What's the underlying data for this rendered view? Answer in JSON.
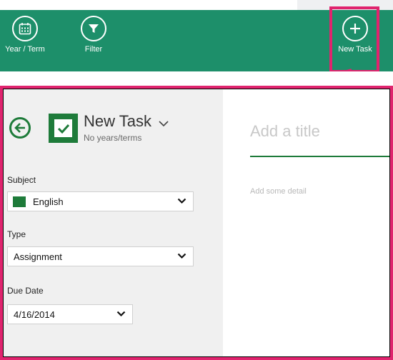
{
  "appbar": {
    "year_term_label": "Year / Term",
    "filter_label": "Filter",
    "new_task_label": "New Task"
  },
  "task": {
    "title": "New Task",
    "subtitle": "No years/terms"
  },
  "form": {
    "subject_label": "Subject",
    "subject_value": "English",
    "subject_color": "#1e7b3a",
    "type_label": "Type",
    "type_value": "Assignment",
    "due_label": "Due Date",
    "due_value": "4/16/2014"
  },
  "editor": {
    "title_placeholder": "Add a title",
    "detail_placeholder": "Add some detail"
  },
  "colors": {
    "appbar": "#1d8f6a",
    "accent": "#1e7b3a",
    "highlight": "#e0246e"
  }
}
